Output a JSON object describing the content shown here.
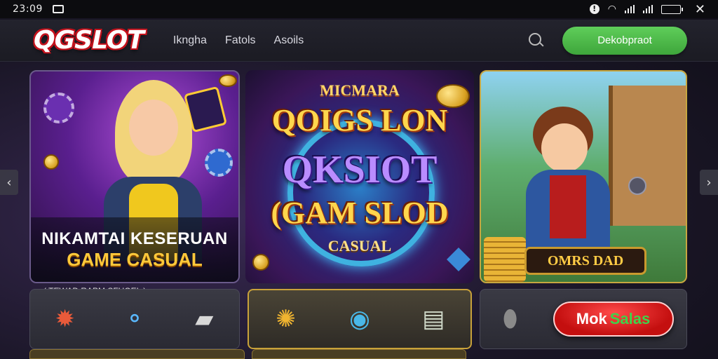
{
  "status_bar": {
    "time": "23:09"
  },
  "header": {
    "logo": "QGSLOT",
    "nav": [
      "Ikngha",
      "Fatols",
      "Asoils"
    ],
    "cta_label": "Dekobpraot"
  },
  "carousel": {
    "card1": {
      "line1": "NIKAMTAI KESERUAN",
      "line2": "GAME CASUAL"
    },
    "card2": {
      "small": "MICMARA",
      "line1": "QOIGS LON",
      "line2": "QKSIOT",
      "line3": "(GAM SLOD",
      "line4": "CASUAL"
    },
    "card3": {
      "banner": "OMRS DAD"
    }
  },
  "tiles": {
    "tile1_label": "( TEWAD RAPM SFUOEL )",
    "promo_main": "Mok",
    "promo_accent": "Salas"
  },
  "colors": {
    "cta": "#4cba48",
    "logo_outline": "#c4121c",
    "gold": "#ffc93a",
    "promo": "#c40f0f"
  }
}
